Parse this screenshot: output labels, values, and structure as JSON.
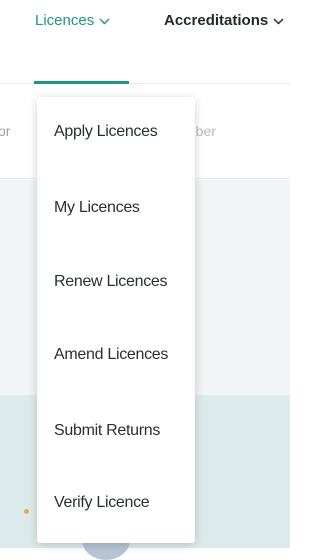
{
  "nav": {
    "items": [
      {
        "label": "Licences",
        "active": true
      },
      {
        "label": "Accreditations",
        "active": false
      }
    ],
    "accent_color": "#1a9a78"
  },
  "subbar": {
    "left_fragment": "or",
    "right_fragment": "mber"
  },
  "dropdown": {
    "items": [
      {
        "label": "Apply Licences"
      },
      {
        "label": "My Licences"
      },
      {
        "label": "Renew Licences"
      },
      {
        "label": "Amend Licences"
      },
      {
        "label": "Submit Returns"
      },
      {
        "label": "Verify Licence"
      }
    ]
  }
}
